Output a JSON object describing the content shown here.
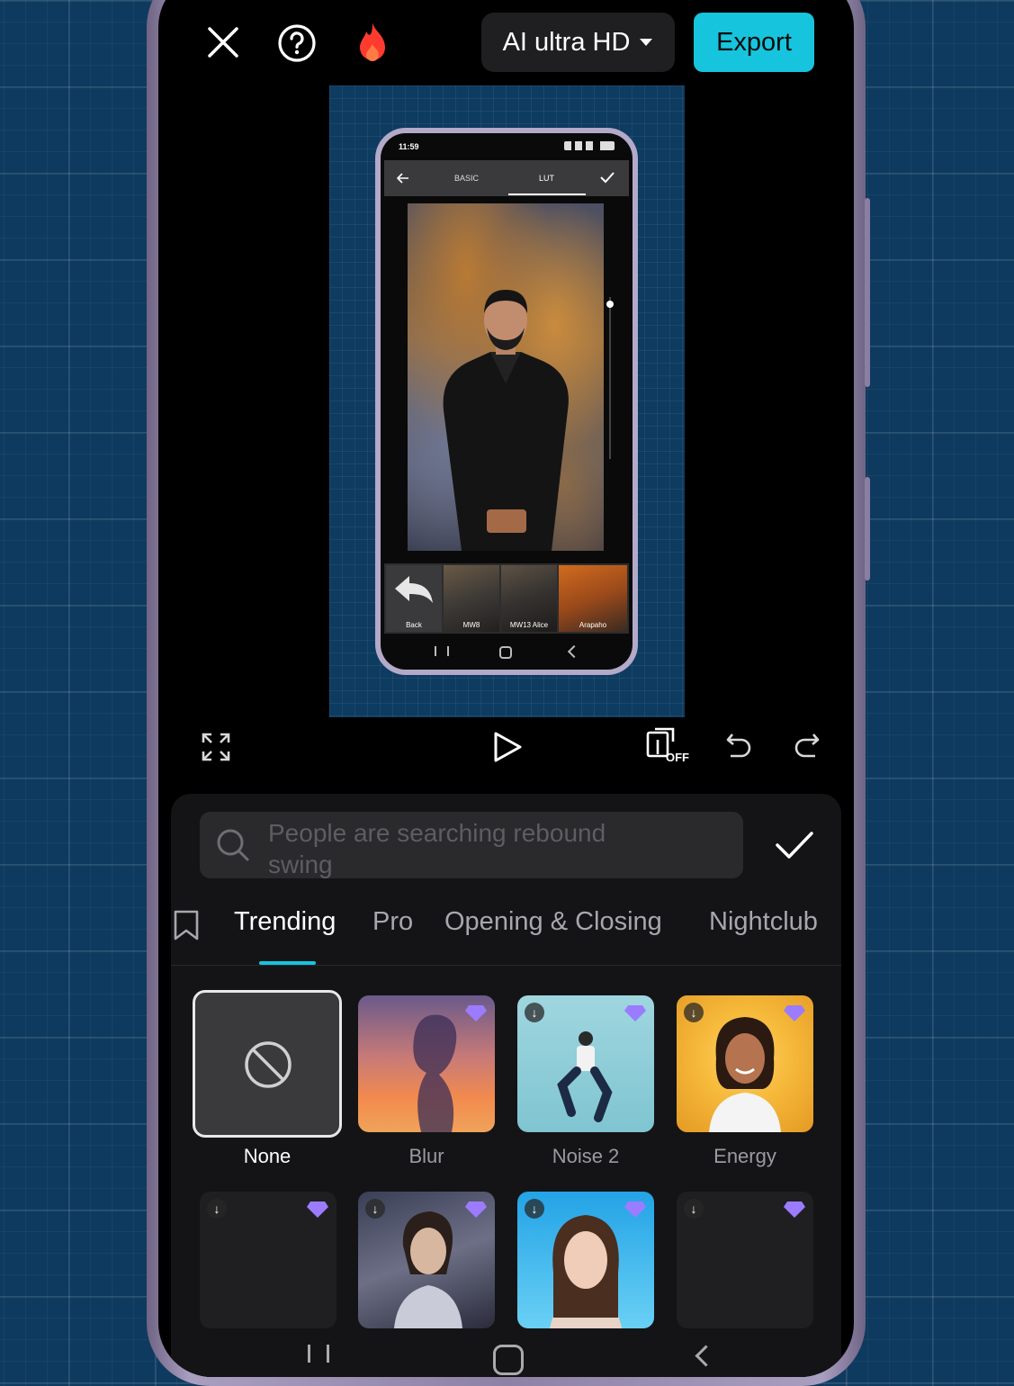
{
  "toolbar": {
    "quality_label": "AI ultra HD",
    "export_label": "Export"
  },
  "preview": {
    "status_time": "11:59",
    "tabs": [
      "BASIC",
      "LUT"
    ],
    "luts": [
      {
        "label": "Back"
      },
      {
        "label": "MW8"
      },
      {
        "label": "MW13 Alice"
      },
      {
        "label": "Arapaho"
      }
    ]
  },
  "controls": {
    "toggle_state": "OFF"
  },
  "panel": {
    "search_placeholder": "People are searching rebound swing",
    "tabs": [
      "Trending",
      "Pro",
      "Opening & Closing",
      "Nightclub"
    ],
    "effects": [
      {
        "label": "None"
      },
      {
        "label": "Blur"
      },
      {
        "label": "Noise 2"
      },
      {
        "label": "Energy"
      }
    ]
  },
  "colors": {
    "accent": "#17c4dd",
    "background": "#0f3a5f",
    "panel": "#141416"
  }
}
